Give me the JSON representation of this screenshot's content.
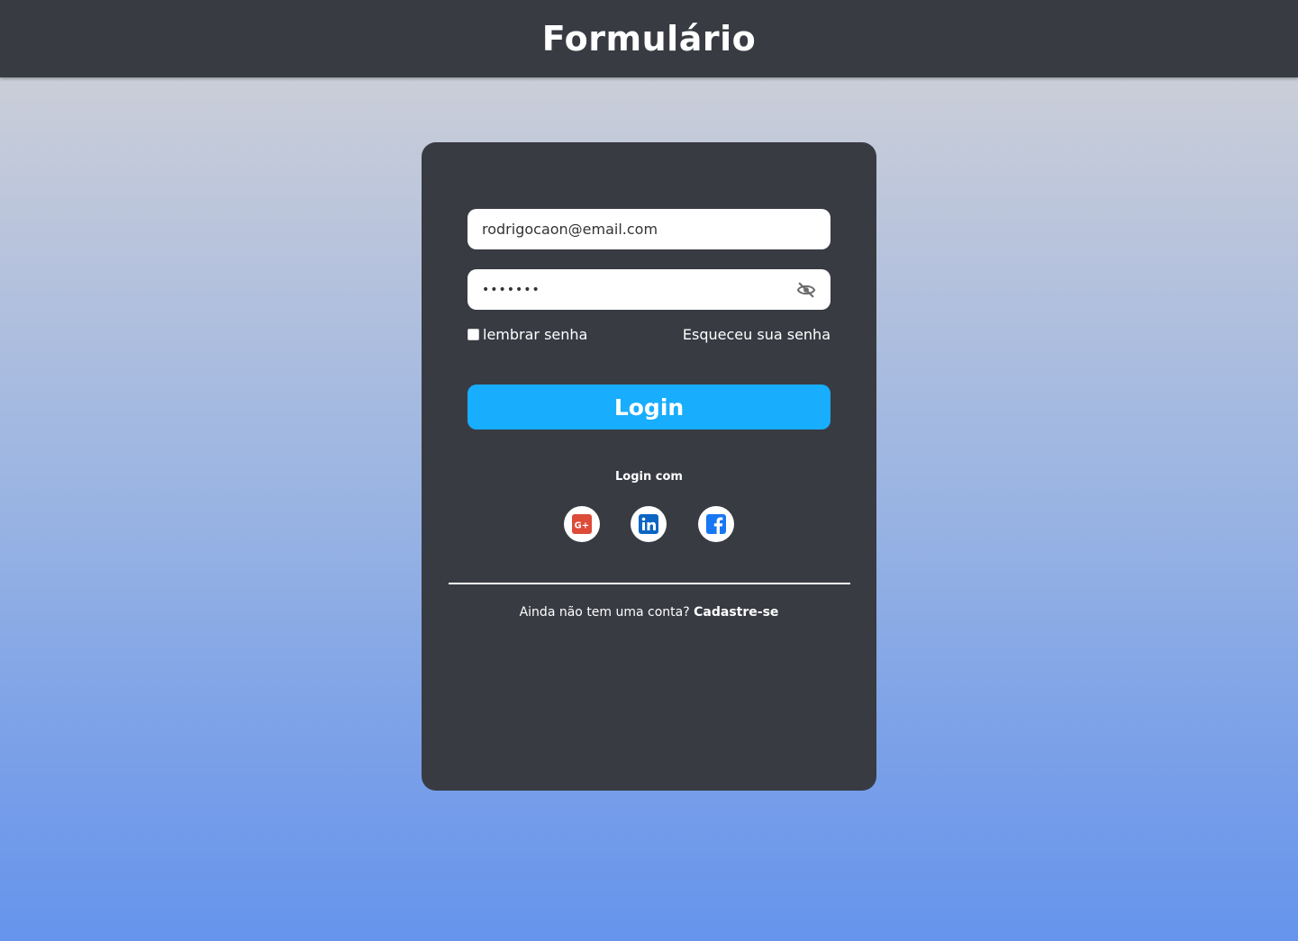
{
  "header": {
    "title": "Formulário"
  },
  "form": {
    "email_value": "rodrigocaon@email.com",
    "password_value": "•••••••",
    "password_toggle_icon": "eye-slash-icon",
    "remember_label": "lembrar senha",
    "remember_checked": false,
    "forgot_label": "Esqueceu sua senha",
    "login_button_label": "Login",
    "login_with_label": "Login com",
    "social": [
      {
        "name": "google-plus",
        "icon": "google-plus-icon",
        "color": "#dd4b39"
      },
      {
        "name": "linkedin",
        "icon": "linkedin-icon",
        "color": "#0a66c2"
      },
      {
        "name": "facebook",
        "icon": "facebook-icon",
        "color": "#1877f2"
      }
    ],
    "signup_prompt": "Ainda não tem uma conta?",
    "signup_link": "Cadastre-se"
  },
  "colors": {
    "header_bg": "#393b43",
    "card_bg": "#393b43",
    "accent": "#18adfd",
    "background_top": "#d2d3d6",
    "background_bottom": "#6694ec"
  }
}
